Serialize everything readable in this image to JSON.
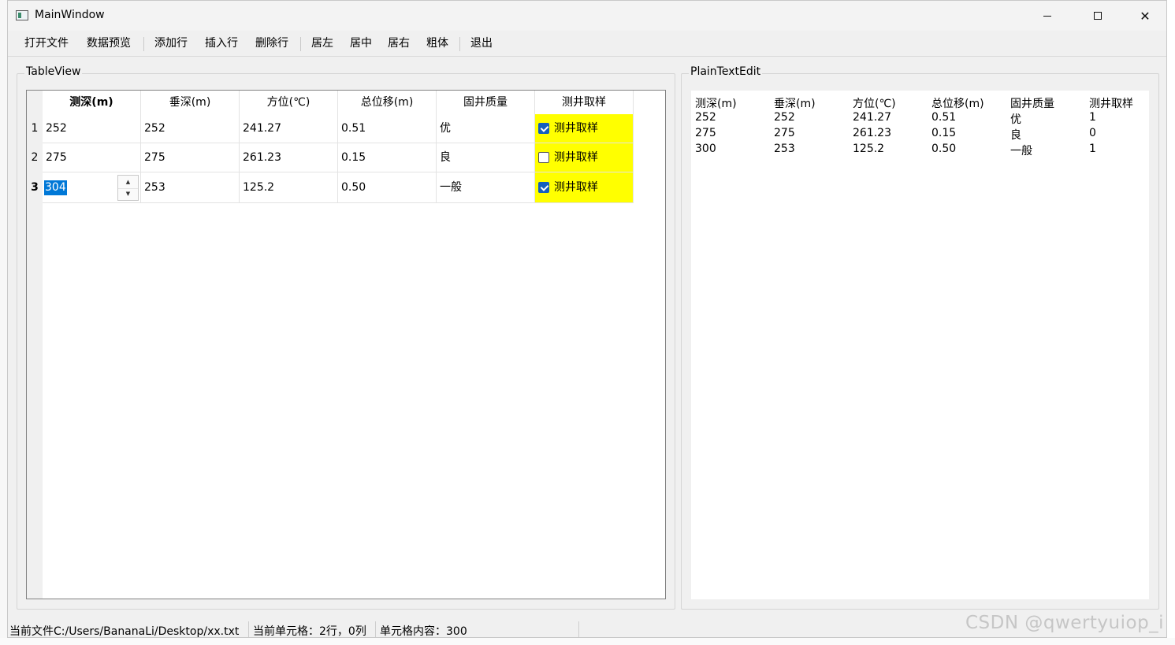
{
  "window": {
    "title": "MainWindow",
    "minimize_symbol": "—",
    "close_symbol": "✕"
  },
  "toolbar": {
    "open_file": "打开文件",
    "preview": "数据预览",
    "add_row": "添加行",
    "insert_row": "插入行",
    "delete_row": "删除行",
    "align_left": "居左",
    "align_center": "居中",
    "align_right": "居右",
    "bold": "粗体",
    "exit": "退出"
  },
  "table_group": {
    "title": "TableView"
  },
  "table": {
    "headers": [
      "测深(m)",
      "垂深(m)",
      "方位(℃)",
      "总位移(m)",
      "固井质量",
      "测井取样"
    ],
    "rows": [
      {
        "num": "1",
        "depth": "252",
        "vdepth": "252",
        "azimuth": "241.27",
        "disp": "0.51",
        "quality": "优",
        "sample_label": "测井取样",
        "checked": true
      },
      {
        "num": "2",
        "depth": "275",
        "vdepth": "275",
        "azimuth": "261.23",
        "disp": "0.15",
        "quality": "良",
        "sample_label": "测井取样",
        "checked": false
      },
      {
        "num": "3",
        "depth": "304",
        "vdepth": "253",
        "azimuth": "125.2",
        "disp": "0.50",
        "quality": "一般",
        "sample_label": "测井取样",
        "checked": true
      }
    ],
    "spin_up": "▲",
    "spin_down": "▼"
  },
  "text_group": {
    "title": "PlainTextEdit"
  },
  "plaintext": {
    "lines": [
      [
        "测深(m)",
        "垂深(m)",
        "方位(℃)",
        "总位移(m)",
        "固井质量",
        "测井取样"
      ],
      [
        "252",
        "252",
        "241.27",
        "0.51",
        "优",
        "1"
      ],
      [
        "275",
        "275",
        "261.23",
        "0.15",
        "良",
        "0"
      ],
      [
        "300",
        "253",
        "125.2",
        "0.50",
        "一般",
        "1"
      ]
    ]
  },
  "statusbar": {
    "file": "当前文件C:/Users/BananaLi/Desktop/xx.txt",
    "cell": "当前单元格：2行，0列",
    "content": "单元格内容：300"
  },
  "watermark": "CSDN @qwertyuiop_i",
  "colors": {
    "checked_cell": "#ffff00",
    "selection": "#0078d7",
    "checkbox": "#1560bd"
  }
}
